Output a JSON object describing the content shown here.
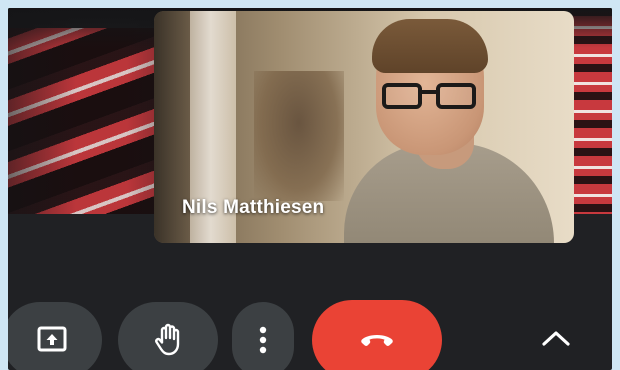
{
  "meeting": {
    "participant_name": "Nils Matthiesen"
  },
  "controls": {
    "present_icon": "present-screen-icon",
    "raise_hand_icon": "raise-hand-icon",
    "more_icon": "more-vertical-icon",
    "hangup_icon": "call-end-icon",
    "expand_icon": "chevron-up-icon"
  },
  "colors": {
    "background": "#202124",
    "control_button": "#3c4043",
    "hangup": "#ea4335",
    "icon": "#ffffff",
    "border": "#cfe6f4"
  }
}
